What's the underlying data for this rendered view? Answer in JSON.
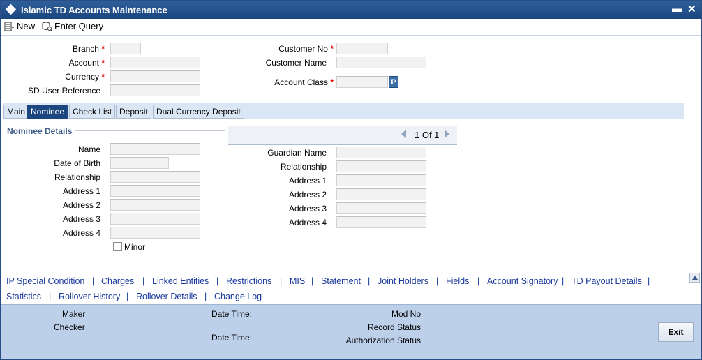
{
  "window": {
    "title": "Islamic TD Accounts Maintenance",
    "minimize": "▬",
    "close": "✕"
  },
  "toolbar": {
    "new_label": "New",
    "enter_query_label": "Enter Query"
  },
  "header_fields": {
    "branch": {
      "label": "Branch",
      "required": "*",
      "value": ""
    },
    "account": {
      "label": "Account",
      "required": "*",
      "value": ""
    },
    "currency": {
      "label": "Currency",
      "required": "*",
      "value": ""
    },
    "sd_user_reference": {
      "label": "SD User Reference",
      "value": ""
    },
    "customer_no": {
      "label": "Customer No",
      "required": "*",
      "value": ""
    },
    "customer_name": {
      "label": "Customer Name",
      "value": ""
    },
    "account_class": {
      "label": "Account Class",
      "required": "*",
      "value": "",
      "lov_button": "P"
    }
  },
  "tabs": [
    {
      "label": "Main",
      "active": false
    },
    {
      "label": "Nominee",
      "active": true
    },
    {
      "label": "Check List",
      "active": false
    },
    {
      "label": "Deposit",
      "active": false
    },
    {
      "label": "Dual Currency Deposit",
      "active": false
    }
  ],
  "nominee": {
    "section_title": "Nominee Details",
    "pager": {
      "text": "1 Of 1"
    },
    "name": {
      "label": "Name",
      "value": ""
    },
    "date_of_birth": {
      "label": "Date of Birth",
      "value": ""
    },
    "relationship": {
      "label": "Relationship",
      "value": ""
    },
    "address1": {
      "label": "Address 1",
      "value": ""
    },
    "address2": {
      "label": "Address 2",
      "value": ""
    },
    "address3": {
      "label": "Address 3",
      "value": ""
    },
    "address4": {
      "label": "Address 4",
      "value": ""
    },
    "minor": {
      "label": "Minor",
      "checked": false
    },
    "guardian_name": {
      "label": "Guardian Name",
      "value": ""
    },
    "guardian_relationship": {
      "label": "Relationship",
      "value": ""
    },
    "guardian_address1": {
      "label": "Address 1",
      "value": ""
    },
    "guardian_address2": {
      "label": "Address 2",
      "value": ""
    },
    "guardian_address3": {
      "label": "Address 3",
      "value": ""
    },
    "guardian_address4": {
      "label": "Address 4",
      "value": ""
    }
  },
  "subsystem_links": {
    "row1": [
      "IP Special Condition",
      "Charges",
      "Linked Entities",
      "Restrictions",
      "MIS",
      "Statement",
      "Joint Holders",
      "Fields",
      "Account Signatory",
      "TD Payout Details"
    ],
    "row2": [
      "Statistics",
      "Rollover History",
      "Rollover Details",
      "Change Log"
    ],
    "separator": "|"
  },
  "footer": {
    "maker": "Maker",
    "checker": "Checker",
    "date_time_1": "Date Time:",
    "date_time_2": "Date Time:",
    "mod_no": "Mod No",
    "record_status": "Record Status",
    "authorization_status": "Authorization Status",
    "exit_label": "Exit"
  },
  "colors": {
    "title_bar": "#1b4680",
    "tab_active": "#1b4680",
    "footer_bg": "#bcd0ea",
    "required": "#e00000",
    "link": "#1a3a9c"
  }
}
